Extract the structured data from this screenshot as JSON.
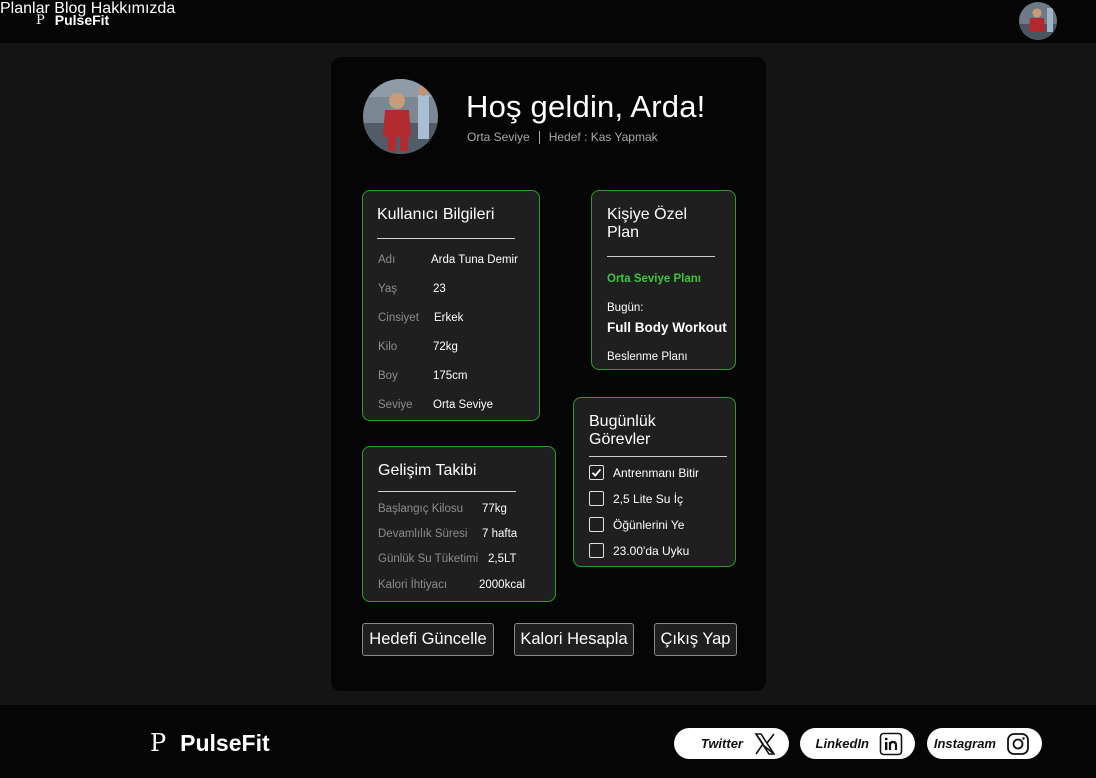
{
  "header": {
    "brand": "PulseFit",
    "nav": [
      "Planlar",
      "Blog",
      "Hakkımızda"
    ]
  },
  "profile": {
    "welcome": "Hoş geldin, Arda!",
    "level": "Orta Seviye",
    "goal": "Hedef : Kas Yapmak"
  },
  "user_info": {
    "title": "Kullanıcı Bilgileri",
    "rows": [
      {
        "k": "Adı",
        "v": "Arda Tuna Demir"
      },
      {
        "k": "Yaş",
        "v": "23"
      },
      {
        "k": "Cinsiyet",
        "v": "Erkek"
      },
      {
        "k": "Kilo",
        "v": "72kg"
      },
      {
        "k": "Boy",
        "v": "175cm"
      },
      {
        "k": "Seviye",
        "v": "Orta Seviye"
      }
    ]
  },
  "plan": {
    "title": "Kişiye Özel Plan",
    "plan_name": "Orta Seviye Planı",
    "today_label": "Bugün:",
    "today_workout": "Full Body Workout",
    "nutrition": "Beslenme Planı"
  },
  "progress": {
    "title": "Gelişim Takibi",
    "rows": [
      {
        "k": "Başlangıç Kilosu",
        "v": "77kg"
      },
      {
        "k": "Devamlılık Süresi",
        "v": "7 hafta"
      },
      {
        "k": "Günlük Su Tüketimi",
        "v": "2,5LT"
      },
      {
        "k": "Kalori İhtiyacı",
        "v": "2000kcal"
      }
    ]
  },
  "tasks": {
    "title": "Bugünlük Görevler",
    "items": [
      {
        "label": "Antrenmanı Bitir",
        "checked": true
      },
      {
        "label": "2,5 Lite Su İç",
        "checked": false
      },
      {
        "label": "Öğünlerini Ye",
        "checked": false
      },
      {
        "label": "23.00'da Uyku",
        "checked": false
      }
    ]
  },
  "actions": {
    "update_goal": "Hedefi Güncelle",
    "calc_calories": "Kalori Hesapla",
    "logout": "Çıkış Yap"
  },
  "footer": {
    "brand": "PulseFit",
    "social": [
      "Twitter",
      "LinkedIn",
      "Instagram"
    ]
  },
  "colors": {
    "accent_green": "#3ec43e",
    "panel_border": "#2f9a2f",
    "background": "#141414"
  }
}
